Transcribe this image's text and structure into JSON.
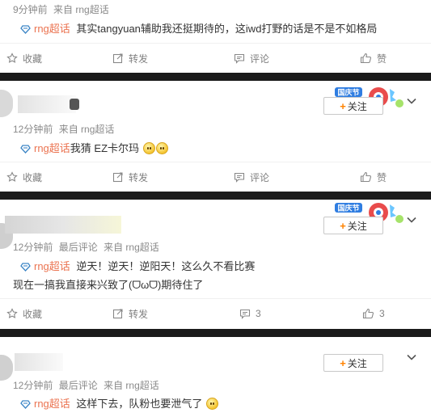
{
  "posts": [
    {
      "meta": {
        "time": "9分钟前",
        "source": "来自 rng超话"
      },
      "topic": "rng超话",
      "text": "其实tangyuan辅助我还挺期待的，这iwd打野的话是不是不如格局",
      "actions": {
        "fav": "收藏",
        "repost": "转发",
        "comment": "评论",
        "like": "赞"
      }
    },
    {
      "meta": {
        "time": "12分钟前",
        "source": "来自 rng超话"
      },
      "topic": "rng超话",
      "text": "我猜 EZ卡尔玛",
      "follow": "关注",
      "actions": {
        "fav": "收藏",
        "repost": "转发",
        "comment": "评论",
        "like": "赞"
      }
    },
    {
      "meta": {
        "time": "12分钟前",
        "extra": "最后评论",
        "source": "来自 rng超话"
      },
      "topic": "rng超话",
      "text": "逆天！逆天！逆阳天！这么久不看比赛",
      "text2": "现在一搞我直接来兴致了(ᗜωᗜ)期待住了",
      "follow": "关注",
      "actions": {
        "fav": "收藏",
        "repost": "转发",
        "comment": "3",
        "like": "3"
      }
    },
    {
      "meta": {
        "time": "12分钟前",
        "extra": "最后评论",
        "source": "来自 rng超话"
      },
      "topic": "rng超话",
      "text": "这样下去，队粉也要泄气了",
      "follow": "关注"
    }
  ],
  "colors": {
    "topic": "#eb7350",
    "follow_plus": "#ff8200",
    "separator": "#1b1b1b",
    "meta": "#8a8a8a"
  },
  "icons": [
    "topic-diamond-icon",
    "favorite-icon",
    "repost-icon",
    "comment-icon",
    "like-icon",
    "chevron-down-icon",
    "national-day-badge-icon",
    "smile-emoji-icon"
  ]
}
